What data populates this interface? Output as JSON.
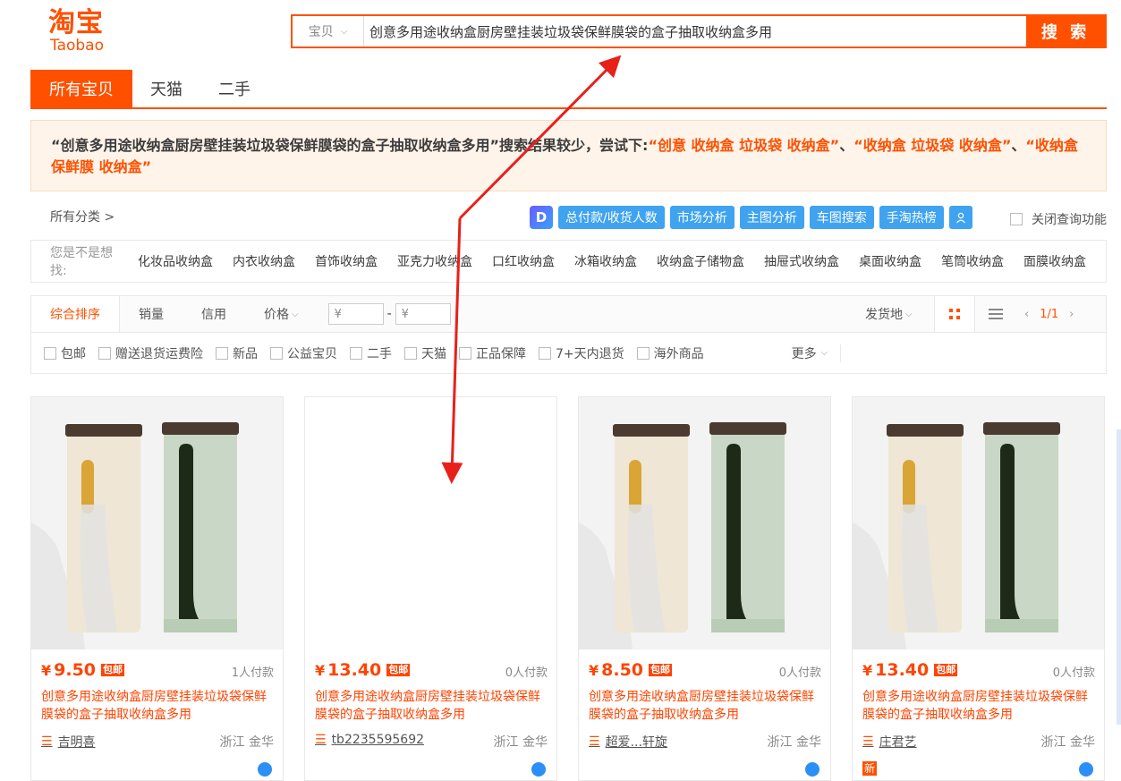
{
  "logo": {
    "cn": "淘宝",
    "en": "Taobao"
  },
  "search": {
    "scope": "宝贝",
    "query": "创意多用途收纳盒厨房壁挂装垃圾袋保鲜膜袋的盒子抽取收纳盒多用",
    "button": "搜 索"
  },
  "tabs": [
    "所有宝贝",
    "天猫",
    "二手"
  ],
  "tip": {
    "prefix": "“创意多用途收纳盒厨房壁挂装垃圾袋保鲜膜袋的盒子抽取收纳盒多用”搜索结果较少，尝试下:",
    "s1": "“创意 收纳盒 垃圾袋 收纳盒”",
    "sep": "、",
    "s2": "“收纳盒 垃圾袋 收纳盒”",
    "s3": "“收纳盒 保鲜膜 收纳盒”"
  },
  "category": "所有分类 >",
  "tools": {
    "d": "D",
    "items": [
      "总付款/收货人数",
      "市场分析",
      "主图分析",
      "车图搜索",
      "手淘热榜"
    ],
    "close_query": "关闭查询功能"
  },
  "suggest": {
    "label": "您是不是想找:",
    "items": [
      "化妆品收纳盒",
      "内衣收纳盒",
      "首饰收纳盒",
      "亚克力收纳盒",
      "口红收纳盒",
      "冰箱收纳盒",
      "收纳盒子储物盒",
      "抽屉式收纳盒",
      "桌面收纳盒",
      "笔筒收纳盒",
      "面膜收纳盒"
    ]
  },
  "sort": {
    "items": [
      "综合排序",
      "销量",
      "信用",
      "价格"
    ],
    "yen1": "¥",
    "yen2": "¥",
    "dash": "-",
    "ship": "发货地",
    "page": "1/1"
  },
  "options": {
    "items": [
      "包邮",
      "赠送退货运费险",
      "新品",
      "公益宝贝",
      "二手",
      "天猫",
      "正品保障",
      "7+天内退货",
      "海外商品"
    ],
    "more": "更多"
  },
  "products": [
    {
      "price": "9.50",
      "badge": "包邮",
      "deals": "1人付款",
      "title": "创意多用途收纳盒厨房壁挂装垃圾袋保鲜膜袋的盒子抽取收纳盒多用",
      "shop": "吉明喜",
      "loc": "浙江 金华",
      "image": true
    },
    {
      "price": "13.40",
      "badge": "包邮",
      "deals": "0人付款",
      "title": "创意多用途收纳盒厨房壁挂装垃圾袋保鲜膜袋的盒子抽取收纳盒多用",
      "shop": "tb2235595692",
      "loc": "浙江 金华",
      "image": false
    },
    {
      "price": "8.50",
      "badge": "包邮",
      "deals": "0人付款",
      "title": "创意多用途收纳盒厨房壁挂装垃圾袋保鲜膜袋的盒子抽取收纳盒多用",
      "shop": "超爱...轩旋",
      "loc": "浙江 金华",
      "image": true
    },
    {
      "price": "13.40",
      "badge": "包邮",
      "deals": "0人付款",
      "title": "创意多用途收纳盒厨房壁挂装垃圾袋保鲜膜袋的盒子抽取收纳盒多用",
      "shop": "庄君艺",
      "loc": "浙江 金华",
      "image": true,
      "new_badge": "新"
    }
  ],
  "currency": "¥",
  "colors": {
    "accent": "#ff5000",
    "tool_blue": "#3fa3f0",
    "annotation_arrow": "#e8201a"
  }
}
